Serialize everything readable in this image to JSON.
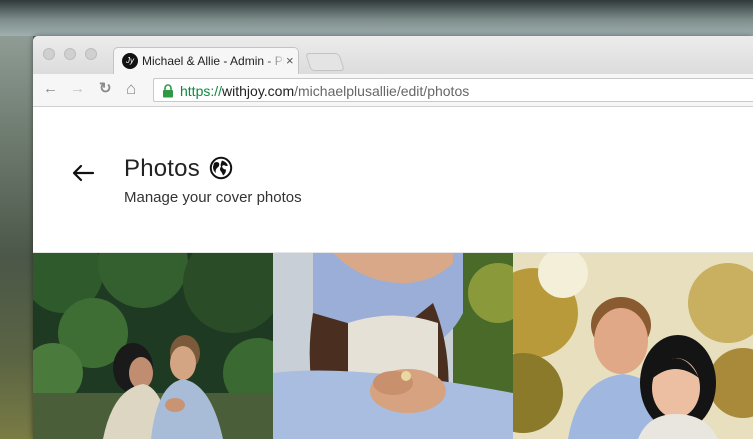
{
  "browser": {
    "tab": {
      "title": "Michael & Allie - Admin - Photos",
      "favicon_text": "Jy",
      "close_glyph": "×"
    },
    "nav": {
      "back_glyph": "←",
      "forward_glyph": "→",
      "reload_glyph": "↻",
      "home_glyph": "⌂"
    },
    "address_bar": {
      "scheme": "https://",
      "domain": "withjoy.com",
      "path": "/michaelplusallie/edit/photos",
      "secure": true
    }
  },
  "page": {
    "title": "Photos",
    "subtitle": "Manage your cover photos",
    "back_icon": "arrow-left-icon",
    "visibility_icon": "globe-icon"
  },
  "photos": [
    {
      "name": "cover-photo-couple-garden",
      "description_icon": "photo"
    },
    {
      "name": "cover-photo-embrace-hands",
      "description_icon": "photo"
    },
    {
      "name": "cover-photo-couple-smiling",
      "description_icon": "photo"
    }
  ],
  "colors": {
    "secure_url": "#0b8a3e",
    "text_primary": "#222222"
  }
}
